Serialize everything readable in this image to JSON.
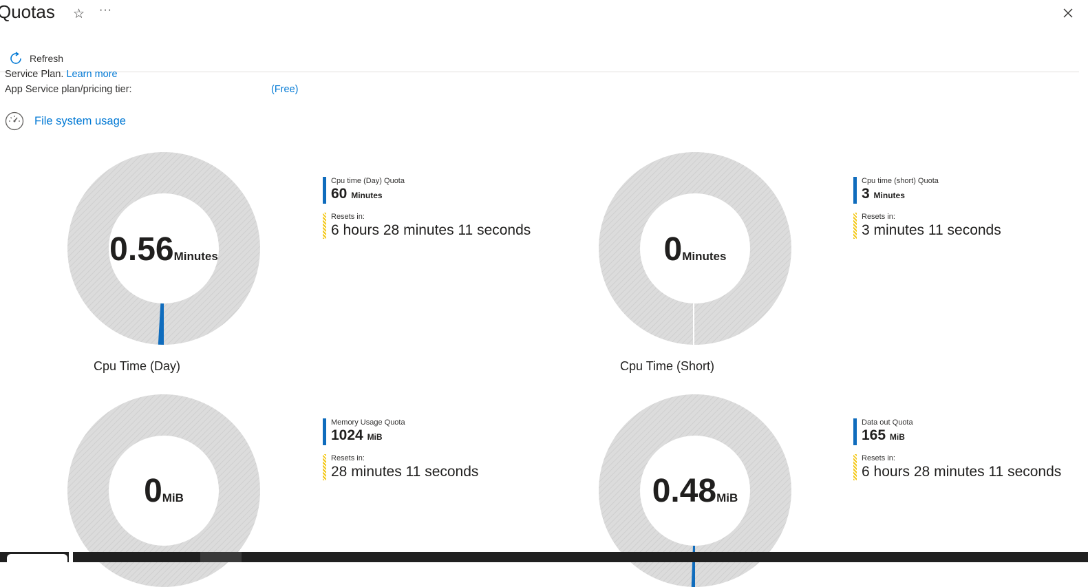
{
  "header": {
    "title": "Quotas",
    "star_icon": "star-icon",
    "more_icon": "more-icon",
    "close_icon": "close-icon"
  },
  "toolbar": {
    "refresh_label": "Refresh"
  },
  "info": {
    "description_text": "Service Plan.",
    "learn_more": "Learn more",
    "tier_label": "App Service plan/pricing tier:",
    "tier_value": "(Free)"
  },
  "file_system": {
    "label": "File system usage"
  },
  "colors": {
    "accent": "#0078d4",
    "usage": "#0f6cbd",
    "reset": "#f4c81a",
    "track": "#d9d9d9"
  },
  "quotas": [
    {
      "name": "Cpu Time (Day)",
      "usage_value": "0.56",
      "usage_unit": "Minutes",
      "quota_label": "Cpu time (Day) Quota",
      "quota_value": "60",
      "quota_unit": "Minutes",
      "resets_label": "Resets in:",
      "resets_value": "6 hours 28 minutes 11 seconds",
      "fraction": 0.0093
    },
    {
      "name": "Cpu Time (Short)",
      "usage_value": "0",
      "usage_unit": "Minutes",
      "quota_label": "Cpu time (short) Quota",
      "quota_value": "3",
      "quota_unit": "Minutes",
      "resets_label": "Resets in:",
      "resets_value": "3 minutes 11 seconds",
      "fraction": 0
    },
    {
      "name": "",
      "usage_value": "0",
      "usage_unit": "MiB",
      "quota_label": "Memory Usage Quota",
      "quota_value": "1024",
      "quota_unit": "MiB",
      "resets_label": "Resets in:",
      "resets_value": "28 minutes 11 seconds",
      "fraction": 0
    },
    {
      "name": "",
      "usage_value": "0.48",
      "usage_unit": "MiB",
      "quota_label": "Data out Quota",
      "quota_value": "165",
      "quota_unit": "MiB",
      "resets_label": "Resets in:",
      "resets_value": "6 hours 28 minutes 11 seconds",
      "fraction": 0.0029
    }
  ]
}
